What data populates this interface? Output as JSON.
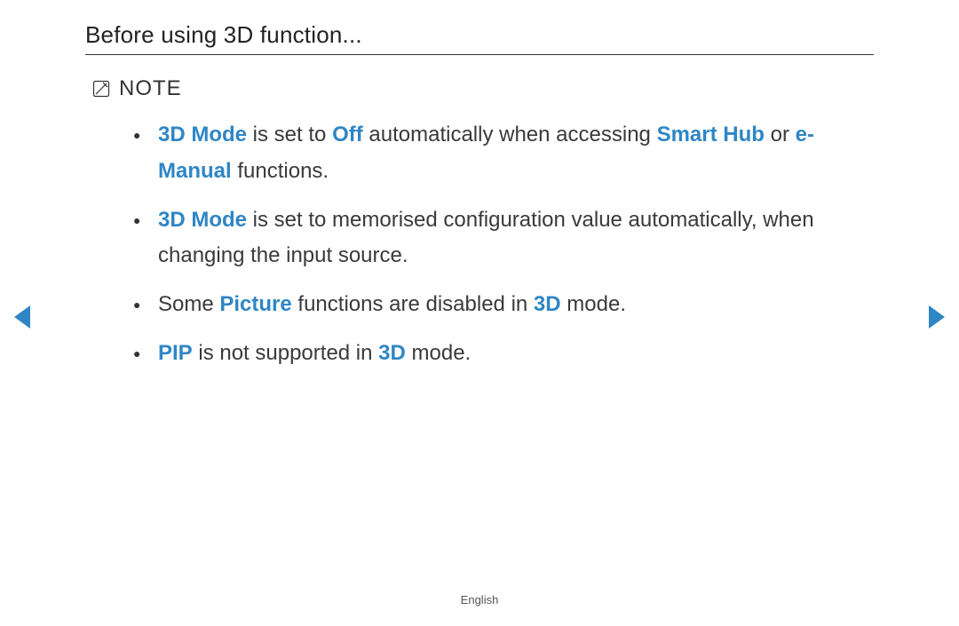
{
  "title": "Before using 3D function...",
  "note_label": "NOTE",
  "bullets": {
    "b1": {
      "t1": "3D Mode",
      "t2": " is set to ",
      "t3": "Off",
      "t4": " automatically when accessing ",
      "t5": "Smart Hub",
      "t6": " or ",
      "t7": "e-Manual",
      "t8": " functions."
    },
    "b2": {
      "t1": "3D Mode",
      "t2": " is set to memorised configuration value automatically, when changing the input source."
    },
    "b3": {
      "t1": "Some ",
      "t2": "Picture",
      "t3": " functions are disabled in ",
      "t4": "3D",
      "t5": " mode."
    },
    "b4": {
      "t1": "PIP",
      "t2": " is not supported in ",
      "t3": "3D",
      "t4": " mode."
    }
  },
  "footer_language": "English"
}
